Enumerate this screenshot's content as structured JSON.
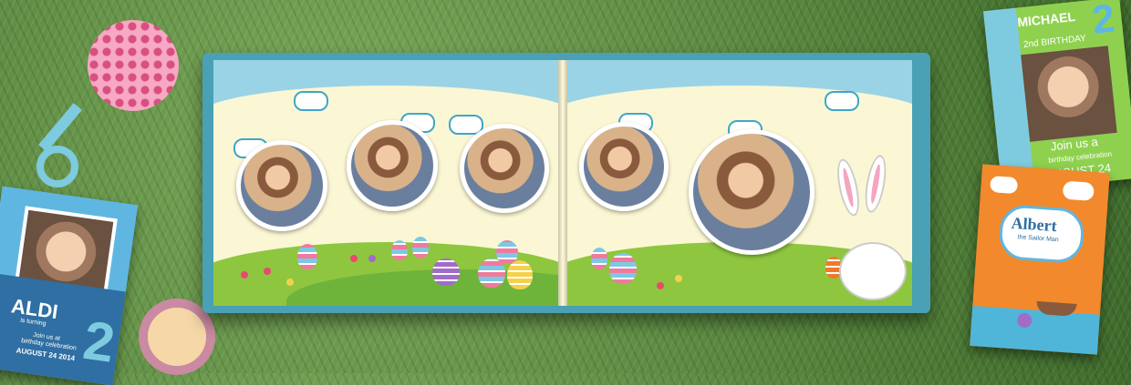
{
  "cards": {
    "aldi": {
      "name": "ALDI",
      "line1": "is turning",
      "line2": "Join us at",
      "line3": "birthday celebration",
      "date": "AUGUST 24 2014",
      "digit": "2"
    },
    "michael": {
      "name": "MICHAEL",
      "subtitle": "2nd BIRTHDAY",
      "join": "Join us a",
      "celebration": "birthday celebration",
      "date": "UGUST 24",
      "digit": "2"
    },
    "albert": {
      "name": "Albert",
      "subtitle": "the Sailor Man"
    }
  },
  "colors": {
    "grass": "#5b8a3c",
    "album_cover": "#4aa0b5",
    "page": "#fbf7d4",
    "sky": "#9bd3e6",
    "hill": "#8fc63f"
  }
}
